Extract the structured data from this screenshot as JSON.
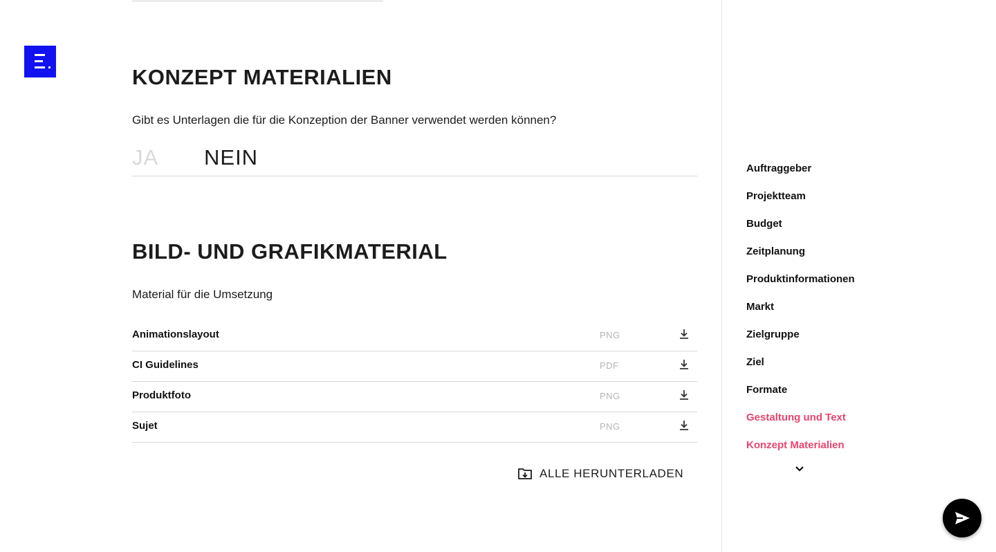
{
  "logo": {
    "icon": "brand-logo-icon",
    "color": "#1212f0"
  },
  "concept": {
    "title": "KONZEPT MATERIALIEN",
    "question": "Gibt es Unterlagen die für die Konzeption der Banner verwendet werden können?",
    "option_yes": "JA",
    "option_no": "NEIN",
    "selected": "NEIN"
  },
  "material": {
    "title": "BILD- UND GRAFIKMATERIAL",
    "subtitle": "Material für die Umsetzung",
    "files": [
      {
        "name": "Animationslayout",
        "type": "PNG"
      },
      {
        "name": "CI Guidelines",
        "type": "PDF"
      },
      {
        "name": "Produktfoto",
        "type": "PNG"
      },
      {
        "name": "Sujet",
        "type": "PNG"
      }
    ],
    "download_all_label": "ALLE HERUNTERLADEN"
  },
  "sidebar": {
    "accent_color": "#e8456e",
    "items": [
      {
        "label": "Auftraggeber",
        "active": false
      },
      {
        "label": "Projektteam",
        "active": false
      },
      {
        "label": "Budget",
        "active": false
      },
      {
        "label": "Zeitplanung",
        "active": false
      },
      {
        "label": "Produktinformationen",
        "active": false
      },
      {
        "label": "Markt",
        "active": false
      },
      {
        "label": "Zielgruppe",
        "active": false
      },
      {
        "label": "Ziel",
        "active": false
      },
      {
        "label": "Formate",
        "active": false
      },
      {
        "label": "Gestaltung und Text",
        "active": true
      },
      {
        "label": "Konzept Materialien",
        "active": true
      }
    ],
    "more_icon": "chevron-down-icon"
  },
  "fab": {
    "icon": "send-icon"
  }
}
